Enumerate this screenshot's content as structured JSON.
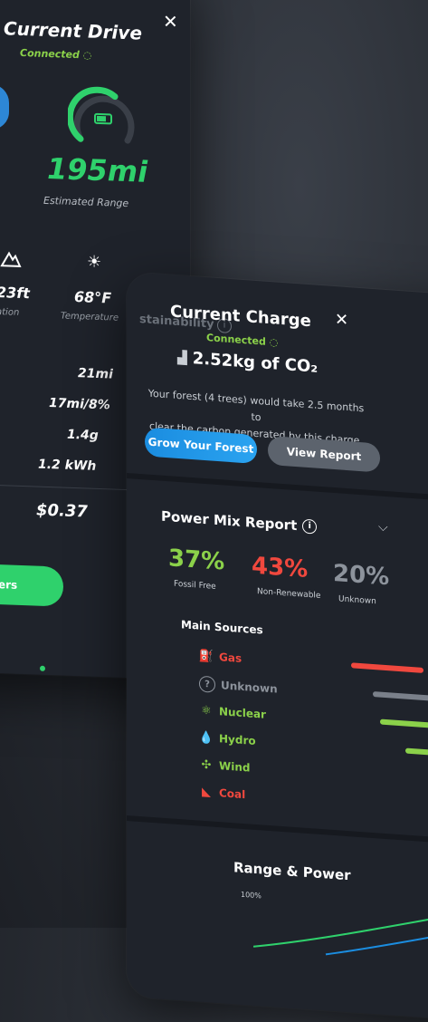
{
  "left": {
    "close": "✕",
    "title": "Current Drive",
    "status": "Connected",
    "range_value": "195mi",
    "range_label": "Estimated Range",
    "alt_value": "23ft",
    "alt_label": "ation",
    "temp_value": "68°F",
    "temp_label": "Temperature",
    "stats": [
      "21mi",
      "17mi/8%",
      "1.4g",
      "1.2 kWh"
    ],
    "cost": "$0.37",
    "cta": "ers"
  },
  "right": {
    "behind_text": "stainability",
    "title": "Current Charge",
    "status": "Connected",
    "co2": "2.52kg of CO₂",
    "desc_line1": "Your forest (4 trees) would take 2.5 months to",
    "desc_line2": "clear the carbon generated by this charge.",
    "grow_btn": "Grow Your Forest",
    "report_btn": "View Report",
    "power_mix_title": "Power Mix Report",
    "mix": [
      {
        "pct": "37%",
        "label": "Fossil Free"
      },
      {
        "pct": "43%",
        "label": "Non-Renewable"
      },
      {
        "pct": "20%",
        "label": "Unknown"
      }
    ],
    "main_sources": "Main Sources",
    "sources": [
      {
        "name": "Gas",
        "color": "#f0483e"
      },
      {
        "name": "Unknown",
        "color": "#8d939c"
      },
      {
        "name": "Nuclear",
        "color": "#8bd14a"
      },
      {
        "name": "Hydro",
        "color": "#8bd14a"
      },
      {
        "name": "Wind",
        "color": "#8bd14a"
      },
      {
        "name": "Coal",
        "color": "#f0483e"
      }
    ],
    "range_power_title": "Range & Power",
    "axis_label": "100%"
  }
}
